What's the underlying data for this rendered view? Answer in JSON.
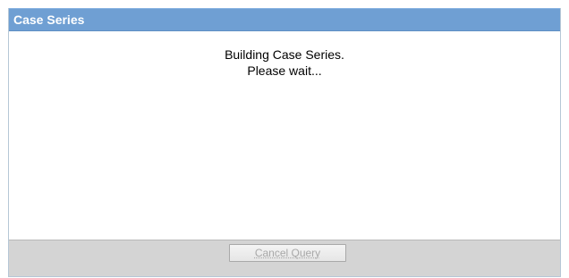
{
  "dialog": {
    "title": "Case Series",
    "message_line1": "Building Case Series.",
    "message_line2": "Please wait...",
    "cancel_button_label": "Cancel Query",
    "cancel_button_disabled": true
  },
  "colors": {
    "titlebar": "#6f9fd3",
    "footer": "#d4d4d4",
    "disabled_text": "#a8a8a8"
  }
}
